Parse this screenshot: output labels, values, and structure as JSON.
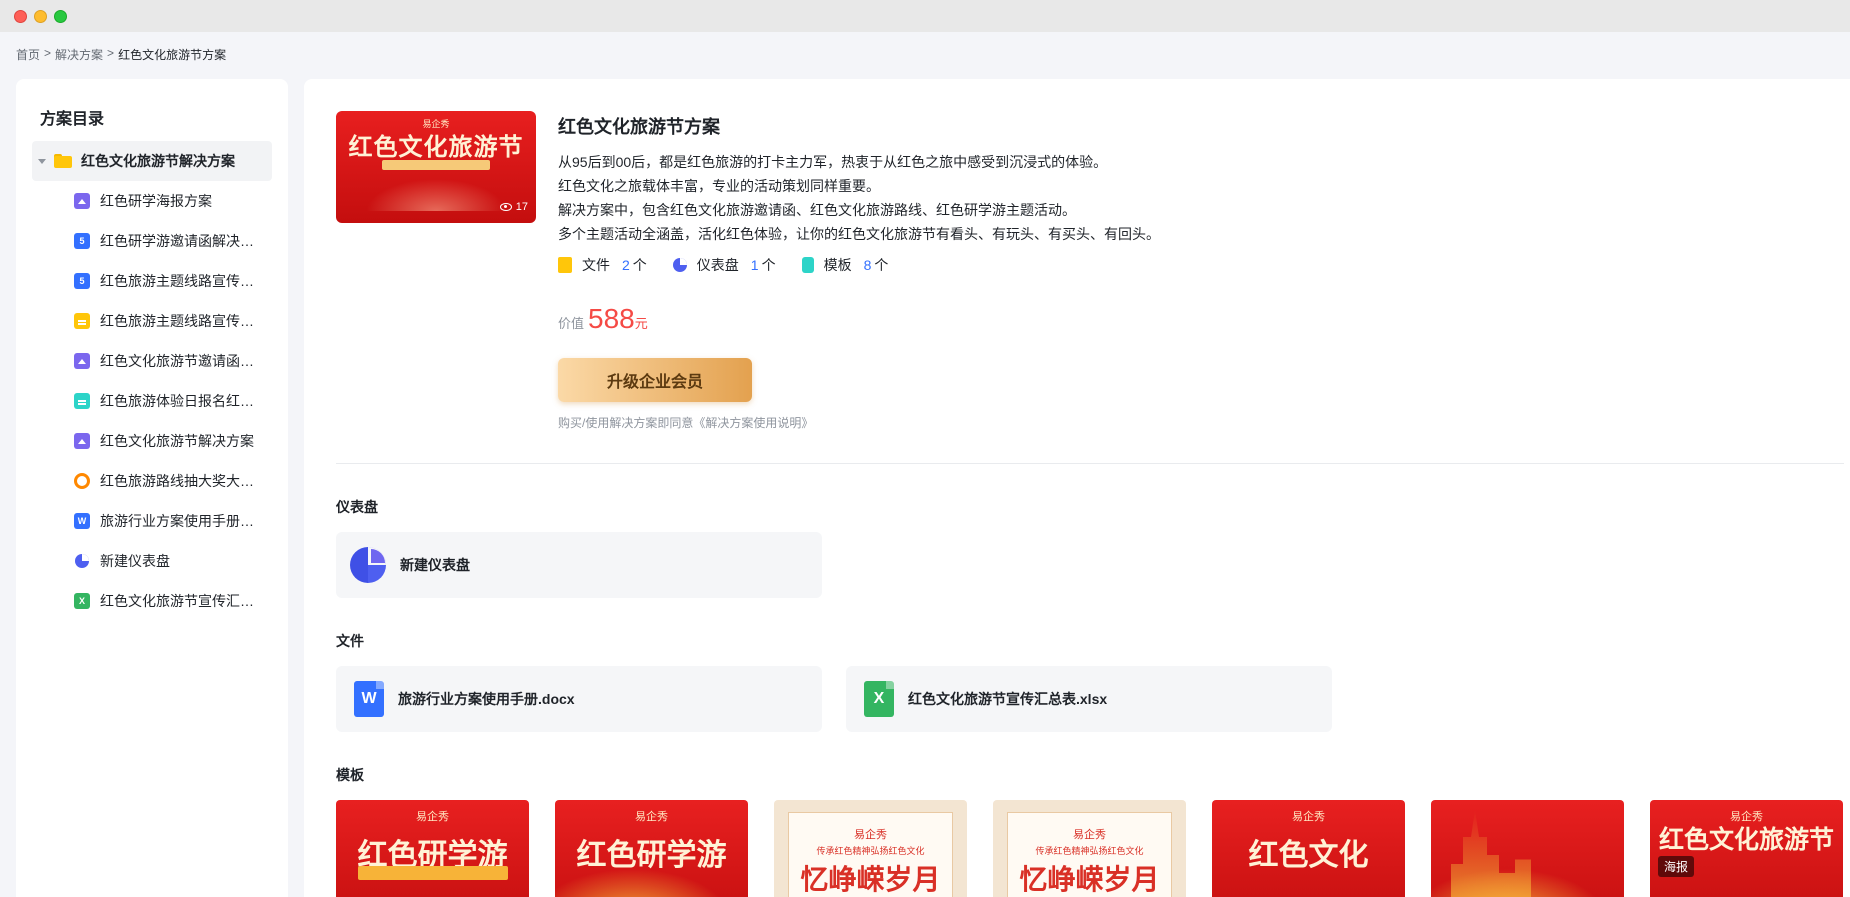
{
  "breadcrumb": {
    "home": "首页",
    "sep1": ">",
    "section": "解决方案",
    "sep2": ">",
    "current": "红色文化旅游节方案"
  },
  "sidebar": {
    "title": "方案目录",
    "root": "红色文化旅游节解决方案",
    "items": [
      {
        "label": "红色研学海报方案",
        "icon": "image-icon"
      },
      {
        "label": "红色研学游邀请函解决方案",
        "icon": "h5-icon"
      },
      {
        "label": "红色旅游主题线路宣传方案",
        "icon": "h5-icon"
      },
      {
        "label": "红色旅游主题线路宣传文档",
        "icon": "doc-icon"
      },
      {
        "label": "红色文化旅游节邀请函方案",
        "icon": "image-icon"
      },
      {
        "label": "红色旅游体验日报名红色表单",
        "icon": "form-icon"
      },
      {
        "label": "红色文化旅游节解决方案",
        "icon": "image-icon"
      },
      {
        "label": "红色旅游路线抽大奖大转盘",
        "icon": "lottery-icon"
      },
      {
        "label": "旅游行业方案使用手册.docx",
        "icon": "word-icon"
      },
      {
        "label": "新建仪表盘",
        "icon": "dashboard-icon"
      },
      {
        "label": "红色文化旅游节宣传汇总表.xlsx",
        "icon": "excel-icon"
      }
    ]
  },
  "cover": {
    "brand": "易企秀",
    "headline": "红色文化旅游节",
    "views": "17"
  },
  "solution": {
    "title": "红色文化旅游节方案",
    "desc": [
      "从95后到00后，都是红色旅游的打卡主力军，热衷于从红色之旅中感受到沉浸式的体验。",
      "红色文化之旅载体丰富，专业的活动策划同样重要。",
      "解决方案中，包含红色文化旅游邀请函、红色文化旅游路线、红色研学游主题活动。",
      "多个主题活动全涵盖，活化红色体验，让你的红色文化旅游节有看头、有玩头、有买头、有回头。"
    ],
    "stats": [
      {
        "label": "文件",
        "count": "2",
        "unit": "个"
      },
      {
        "label": "仪表盘",
        "count": "1",
        "unit": "个"
      },
      {
        "label": "模板",
        "count": "8",
        "unit": "个"
      }
    ],
    "price_label": "价值",
    "price_value": "588",
    "price_unit": "元",
    "upgrade_label": "升级企业会员",
    "agreement": "购买/使用解决方案即同意《解决方案使用说明》"
  },
  "sections": {
    "dashboard": {
      "title": "仪表盘",
      "items": [
        "新建仪表盘"
      ]
    },
    "files": {
      "title": "文件",
      "items": [
        {
          "name": "旅游行业方案使用手册.docx",
          "icon_text": "W"
        },
        {
          "name": "红色文化旅游节宣传汇总表.xlsx",
          "icon_text": "X"
        }
      ]
    },
    "templates": {
      "title": "模板",
      "items": [
        {
          "brand": "易企秀",
          "headline": "红色研学游"
        },
        {
          "brand": "易企秀",
          "headline": "红色研学游"
        },
        {
          "brand": "易企秀",
          "small": "传承红色精神弘扬红色文化",
          "headline": "忆峥嵘岁月"
        },
        {
          "brand": "易企秀",
          "small": "传承红色精神弘扬红色文化",
          "headline": "忆峥嵘岁月"
        },
        {
          "brand": "易企秀",
          "headline": "红色文化"
        },
        {
          "brand": "",
          "headline": ""
        },
        {
          "brand": "易企秀",
          "headline": "红色文化旅游节",
          "badge": "海报"
        }
      ]
    }
  },
  "colors": {
    "accent": "#3370ff",
    "price": "#f54a45",
    "brand_red": "#d81e1e",
    "gold": "#e3a14f"
  }
}
